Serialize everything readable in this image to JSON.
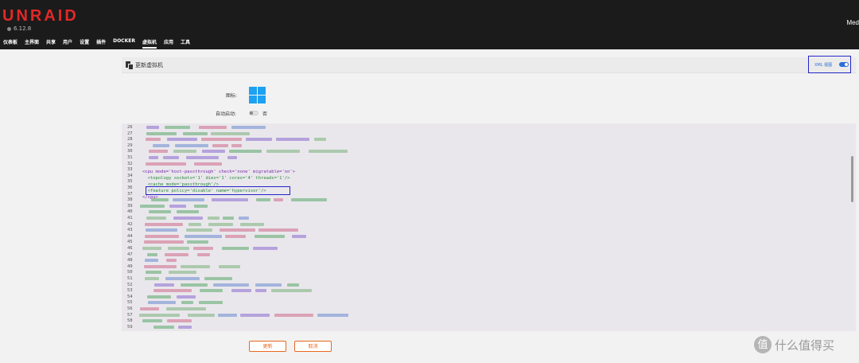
{
  "app": {
    "logo": "UNRAID",
    "version": "6.12.8",
    "server_name": "Med"
  },
  "nav": {
    "items": [
      {
        "label": "仪表板"
      },
      {
        "label": "主界面"
      },
      {
        "label": "共享"
      },
      {
        "label": "用户"
      },
      {
        "label": "设置"
      },
      {
        "label": "插件"
      },
      {
        "label": "DOCKER"
      },
      {
        "label": "虚拟机",
        "active": true
      },
      {
        "label": "应用"
      },
      {
        "label": "工具"
      }
    ]
  },
  "page": {
    "title": "更新虚拟机",
    "xml_view_label": "XML 视图",
    "xml_view_on": true,
    "icon_label": "图标:",
    "icon_name": "windows-logo-icon",
    "autostart_label": "自动启动:",
    "autostart_value": "否",
    "autostart_on": false
  },
  "editor": {
    "line_numbers": [
      "26",
      "27",
      "28",
      "29",
      "30",
      "31",
      "32",
      "33",
      "34",
      "35",
      "36",
      "37",
      "38",
      "39",
      "40",
      "41",
      "42",
      "43",
      "44",
      "45",
      "46",
      "47",
      "48",
      "49",
      "50",
      "51",
      "52",
      "53",
      "54",
      "55",
      "56",
      "57",
      "58",
      "59"
    ],
    "visible_lines": {
      "l33": "<cpu mode='host-passthrough' check='none' migratable='on'>",
      "l34": "  <topology sockets='1' dies='1' cores='4' threads='1'/>",
      "l35": "  <cache mode='passthrough'/>",
      "l36": "  <feature policy='disable' name='hypervisor'/>",
      "l37": "</cpu>"
    }
  },
  "buttons": {
    "update": "更新",
    "cancel": "取消"
  },
  "watermark": {
    "glyph": "值",
    "text": "什么值得买"
  },
  "colors": {
    "brand": "#e22828",
    "accent_blue": "#2d6fd6",
    "button_orange": "#e8691e",
    "windows_blue": "#1da1f2",
    "highlight_box": "#2424c8"
  }
}
